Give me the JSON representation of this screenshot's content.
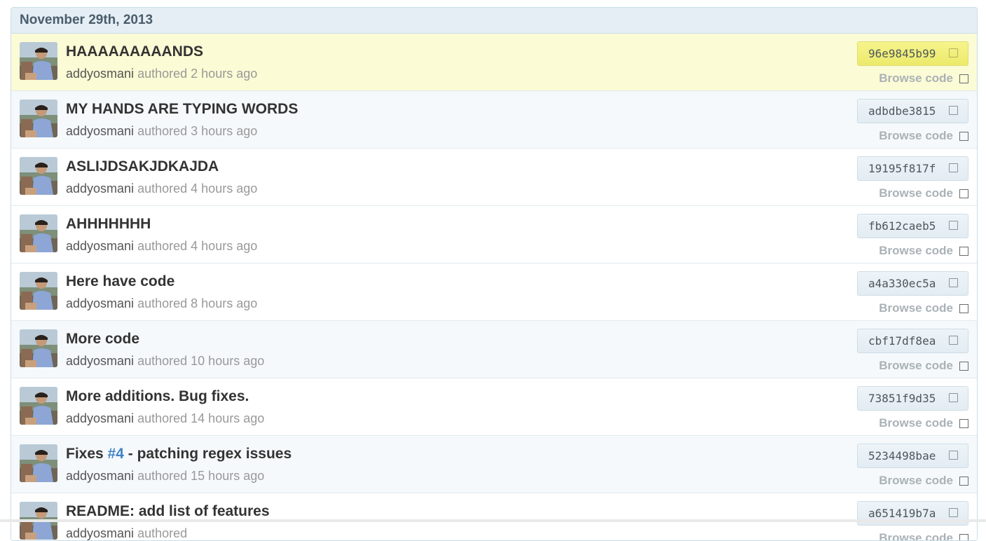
{
  "group": {
    "date_label": "November 29th, 2013"
  },
  "labels": {
    "authored": "authored",
    "browse_code": "Browse code"
  },
  "commits": [
    {
      "title": "HAAAAAAAAANDS",
      "author": "addyosmani",
      "time": "2 hours ago",
      "sha": "96e9845b99",
      "state": "highlight"
    },
    {
      "title": "MY HANDS ARE TYPING WORDS",
      "author": "addyosmani",
      "time": "3 hours ago",
      "sha": "adbdbe3815",
      "state": "alt"
    },
    {
      "title": "ASLIJDSAKJDKAJDA",
      "author": "addyosmani",
      "time": "4 hours ago",
      "sha": "19195f817f",
      "state": "normal"
    },
    {
      "title": "AHHHHHHH",
      "author": "addyosmani",
      "time": "4 hours ago",
      "sha": "fb612caeb5",
      "state": "normal"
    },
    {
      "title": "Here have code",
      "author": "addyosmani",
      "time": "8 hours ago",
      "sha": "a4a330ec5a",
      "state": "normal"
    },
    {
      "title": "More code",
      "author": "addyosmani",
      "time": "10 hours ago",
      "sha": "cbf17df8ea",
      "state": "alt"
    },
    {
      "title": "More additions. Bug fixes.",
      "author": "addyosmani",
      "time": "14 hours ago",
      "sha": "73851f9d35",
      "state": "normal"
    },
    {
      "title_prefix": "Fixes ",
      "issue_ref": "#4",
      "title_suffix": " - patching regex issues",
      "author": "addyosmani",
      "time": "15 hours ago",
      "sha": "5234498bae",
      "state": "alt"
    },
    {
      "title": "README: add list of features",
      "author": "addyosmani",
      "time": "",
      "sha": "a651419b7a",
      "state": "normal"
    }
  ],
  "colors": {
    "header_bg": "#e4eef4",
    "highlight_row": "#fbfbd5",
    "alt_row": "#f5f9fb",
    "link_blue": "#4183c4"
  },
  "icons": {
    "copy": "clipboard-icon",
    "browse": "browse-code-icon"
  }
}
